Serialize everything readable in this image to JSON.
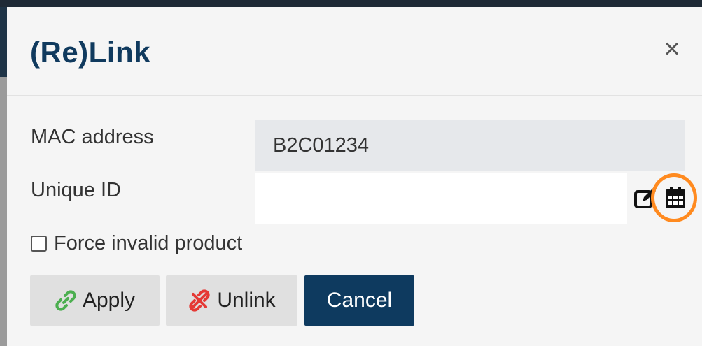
{
  "dialog": {
    "title": "(Re)Link",
    "close_glyph": "×"
  },
  "form": {
    "mac_label": "MAC address",
    "mac_value": "B2C01234",
    "uid_label": "Unique ID",
    "uid_value": "",
    "force_label": "Force invalid product",
    "force_checked": false
  },
  "buttons": {
    "apply": "Apply",
    "unlink": "Unlink",
    "cancel": "Cancel"
  },
  "icons": {
    "apply": "link-icon",
    "unlink": "unlink-icon",
    "edit": "edit-icon",
    "calendar": "calendar-icon"
  },
  "colors": {
    "title": "#103a5e",
    "cancel_bg": "#0e3a5f",
    "apply_icon": "#4caf50",
    "unlink_icon": "#e53935",
    "highlight": "#ff8a1f"
  }
}
